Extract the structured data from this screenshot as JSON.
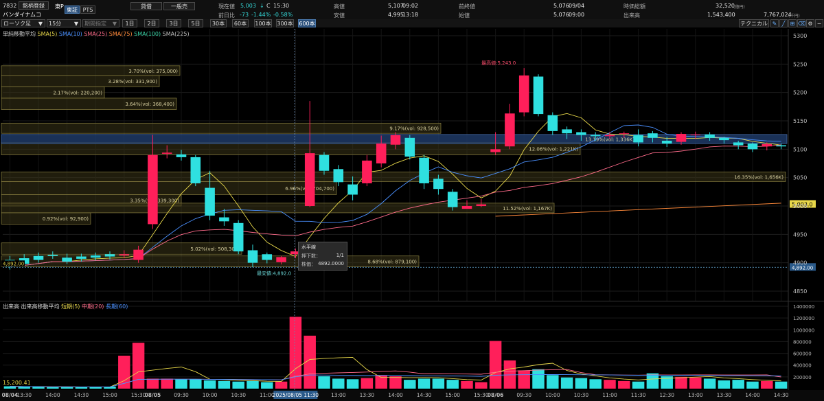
{
  "header": {
    "code": "7832",
    "name": "バンダイナムコ",
    "tabs": [
      "銘柄登録",
      "東P",
      "東証",
      "PTS"
    ],
    "mode_buttons": [
      "貸借",
      "一般売"
    ]
  },
  "quote": {
    "current_label": "現在値",
    "current_value": "5,003",
    "current_arrow": "↓",
    "current_flag": "C",
    "current_time": "15:30",
    "prev_diff_label": "前日比",
    "prev_diff": "-73",
    "prev_diff_pct": "-1.44%",
    "prev_diff_pct2": "-0.58%",
    "high_label": "高値",
    "high_value": "5,107",
    "high_time": "09:02",
    "low_label": "安値",
    "low_value": "4,995",
    "low_time": "13:18",
    "prev_close_label": "前終値",
    "prev_close_value": "5,076",
    "prev_close_date": "09/04",
    "open_label": "始値",
    "open_value": "5,076",
    "open_time": "09:00",
    "market_cap_label": "時価総額",
    "market_cap_value": "32,520",
    "market_cap_unit": "(億円)",
    "volume_label": "出来高",
    "volume_value": "1,543,400",
    "turnover_value": "7,767,024",
    "turnover_unit": "(千円)"
  },
  "toolbar": {
    "chart_type": "ローソク足",
    "interval": "15分",
    "period_placeholder": "期間指定",
    "ranges": [
      "1日",
      "2日",
      "3日",
      "5日",
      "30本",
      "60本",
      "100本",
      "300本",
      "600本"
    ],
    "active_range": "600本",
    "technical_label": "テクニカル"
  },
  "price_panel": {
    "title": "単純移動平均",
    "sma_labels": [
      {
        "text": "SMA(5)",
        "color": "#e8d84a"
      },
      {
        "text": "SMA(10)",
        "color": "#4a90ff"
      },
      {
        "text": "SMA(25)",
        "color": "#ff6b8a"
      },
      {
        "text": "SMA(75)",
        "color": "#ff8a3a"
      },
      {
        "text": "SMA(100)",
        "color": "#3ad6a8"
      },
      {
        "text": "SMA(225)",
        "color": "#c0c0c0"
      }
    ],
    "annotations": {
      "high": "最高値:5,243.0",
      "low": "最安値:4,892.0",
      "left_price": "4,892.00",
      "right_price_current": "5,003.0",
      "right_price_low": "4,892.00"
    },
    "tooltip": {
      "title": "水平線",
      "row1_label": "押下数：",
      "row1_value": "1/1",
      "row2_label": "株価：",
      "row2_value": "4892.0000"
    },
    "volume_profile": [
      "3.70%(vol: 375,000)",
      "3.28%(vol: 331,900)",
      "2.17%(vol: 220,200)",
      "3.64%(vol: 368,400)",
      "9.17%(vol: 928,500)",
      "13.19%(vol: 1,336K)",
      "12.06%(vol: 1,221K)",
      "16.35%(vol: 1,656K)",
      "6.96%(vol: 704,700)",
      "3.35%(vol: 339,300)",
      "11.52%(vol: 1,167K)",
      "0.92%(vol: 92,900)",
      "5.02%(vol: 508,300)",
      "8.68%(vol: 879,100)"
    ]
  },
  "volume_panel": {
    "title": "出来高",
    "legend_title": "出来高移動平均",
    "ma_labels": [
      {
        "text": "短期(5)",
        "color": "#e8d84a"
      },
      {
        "text": "中期(20)",
        "color": "#ff6b8a"
      },
      {
        "text": "長期(60)",
        "color": "#4a90ff"
      }
    ],
    "left_value": "15,200.41"
  },
  "x_axis": {
    "labels": [
      "08/04",
      "13:30",
      "14:00",
      "14:30",
      "15:00",
      "15:30",
      "08/05",
      "09:30",
      "10:00",
      "10:30",
      "11:00",
      "2025/08/05 11:30",
      "13:00",
      "13:30",
      "14:00",
      "14:30",
      "15:00",
      "15:30",
      "08/06",
      "09:30",
      "10:00",
      "10:30",
      "11:00",
      "11:30",
      "12:30",
      "13:00",
      "13:30",
      "14:00",
      "14:30"
    ]
  },
  "chart_data": {
    "type": "candlestick",
    "interval": "15分",
    "x": [
      "08/04 13:15",
      "08/04 13:30",
      "08/04 13:45",
      "08/04 14:00",
      "08/04 14:15",
      "08/04 14:30",
      "08/04 14:45",
      "08/04 15:00",
      "08/04 15:15",
      "08/04 15:30",
      "08/05 09:00",
      "08/05 09:15",
      "08/05 09:30",
      "08/05 09:45",
      "08/05 10:00",
      "08/05 10:15",
      "08/05 10:30",
      "08/05 10:45",
      "08/05 11:00",
      "08/05 11:15",
      "08/05 11:30",
      "08/05 12:30",
      "08/05 12:45",
      "08/05 13:00",
      "08/05 13:15",
      "08/05 13:30",
      "08/05 13:45",
      "08/05 14:00",
      "08/05 14:15",
      "08/05 14:30",
      "08/05 14:45",
      "08/05 15:00",
      "08/05 15:15",
      "08/05 15:30",
      "08/06 09:00",
      "08/06 09:15",
      "08/06 09:30",
      "08/06 09:45",
      "08/06 10:00",
      "08/06 10:15",
      "08/06 10:30",
      "08/06 10:45",
      "08/06 11:00",
      "08/06 11:15",
      "08/06 11:30",
      "08/06 12:30",
      "08/06 12:45",
      "08/06 13:00",
      "08/06 13:15",
      "08/06 13:30",
      "08/06 13:45",
      "08/06 14:00",
      "08/06 14:15",
      "08/06 14:30",
      "08/06 14:45"
    ],
    "open": [
      4905,
      4908,
      4912,
      4914,
      4909,
      4911,
      4913,
      4915,
      4913,
      4905,
      4968,
      5092,
      5091,
      5086,
      5032,
      4980,
      4970,
      4922,
      4915,
      4901,
      4915,
      5000,
      5090,
      5065,
      5038,
      5040,
      5075,
      5108,
      5120,
      5085,
      5048,
      5025,
      4995,
      5000,
      5095,
      5105,
      5165,
      5228,
      5160,
      5135,
      5130,
      5125,
      5123,
      5127,
      5125,
      5128,
      5115,
      5113,
      5125,
      5126,
      5120,
      5112,
      5110,
      5105,
      5107
    ],
    "close": [
      4893,
      4898,
      4905,
      4912,
      4902,
      4907,
      4909,
      4911,
      4915,
      4923,
      5090,
      5094,
      5086,
      5040,
      4983,
      4973,
      4920,
      4900,
      4905,
      4910,
      4920,
      5093,
      5062,
      5042,
      5020,
      5080,
      5110,
      5125,
      5087,
      5040,
      5030,
      4998,
      5000,
      5003,
      5100,
      5163,
      5230,
      5162,
      5132,
      5128,
      5125,
      5123,
      5125,
      5128,
      5112,
      5120,
      5110,
      5127,
      5126,
      5120,
      5116,
      5107,
      5100,
      5109,
      5105
    ],
    "high": [
      4912,
      4915,
      4918,
      4920,
      4916,
      4916,
      4918,
      4920,
      4922,
      4930,
      5125,
      5107,
      5099,
      5090,
      5062,
      4995,
      4975,
      4932,
      4918,
      4912,
      4925,
      5185,
      5095,
      5072,
      5052,
      5090,
      5124,
      5130,
      5125,
      5090,
      5055,
      5030,
      5010,
      5012,
      5130,
      5180,
      5243,
      5232,
      5165,
      5140,
      5135,
      5130,
      5130,
      5131,
      5135,
      5132,
      5122,
      5130,
      5131,
      5130,
      5122,
      5115,
      5112,
      5112,
      5110
    ],
    "low": [
      4888,
      4893,
      4900,
      4907,
      4898,
      4902,
      4904,
      4906,
      4908,
      4900,
      4960,
      5084,
      5080,
      5035,
      4975,
      4965,
      4915,
      4892,
      4899,
      4897,
      4908,
      4998,
      5055,
      5035,
      5010,
      5035,
      5068,
      5100,
      5082,
      5030,
      5020,
      4992,
      4995,
      4998,
      5090,
      5100,
      5158,
      5158,
      5125,
      5118,
      5115,
      5115,
      5118,
      5120,
      5105,
      5112,
      5104,
      5108,
      5118,
      5115,
      5110,
      5100,
      5095,
      5098,
      5100
    ],
    "volume": [
      40000,
      30000,
      32000,
      25000,
      30000,
      28000,
      26000,
      35000,
      560000,
      780000,
      170000,
      170000,
      160000,
      160000,
      140000,
      130000,
      120000,
      130000,
      110000,
      120000,
      1220000,
      900000,
      210000,
      170000,
      160000,
      180000,
      230000,
      210000,
      150000,
      170000,
      170000,
      150000,
      130000,
      110000,
      810000,
      480000,
      310000,
      330000,
      230000,
      190000,
      180000,
      160000,
      150000,
      130000,
      120000,
      260000,
      210000,
      200000,
      190000,
      170000,
      140000,
      150000,
      120000,
      130000,
      120000
    ],
    "ylim_price": [
      4850,
      5300
    ],
    "ylim_volume": [
      0,
      1400000
    ],
    "y_ticks_price": [
      "4850",
      "4900",
      "4950",
      "5000",
      "5050",
      "5100",
      "5150",
      "5200",
      "5250",
      "5300"
    ],
    "y_ticks_volume": [
      "200000",
      "400000",
      "600000",
      "800000",
      "1000000",
      "1200000",
      "1400000"
    ]
  }
}
